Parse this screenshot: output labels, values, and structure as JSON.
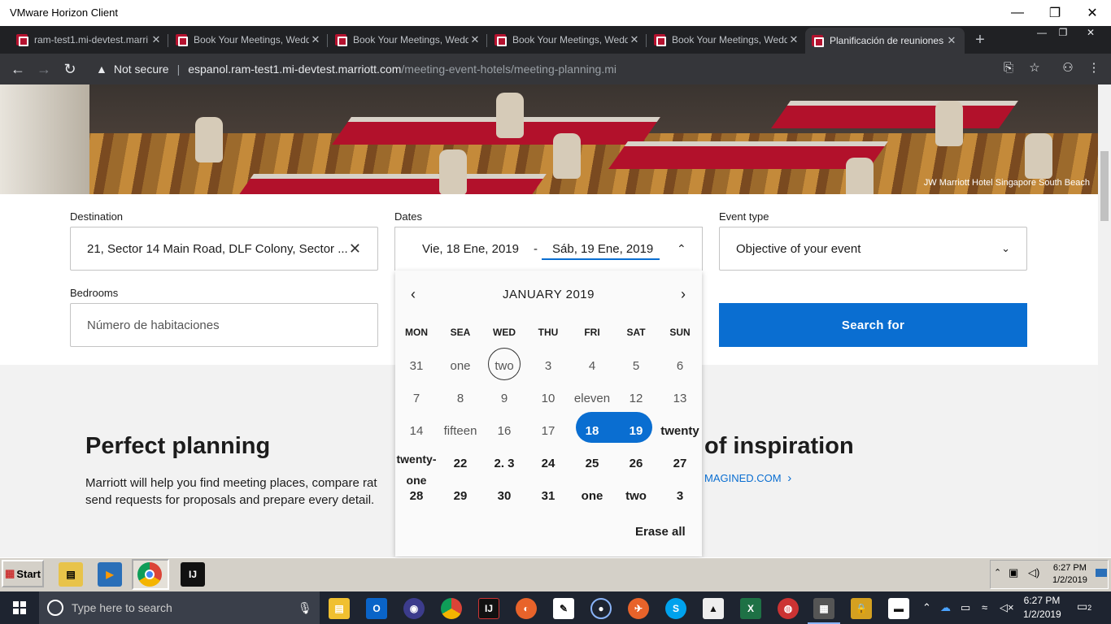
{
  "horizon": {
    "title": "VMware Horizon Client"
  },
  "window_controls": {
    "minimize": "—",
    "restore": "❐",
    "close": "✕"
  },
  "tabs": [
    {
      "label": "ram-test1.mi-devtest.marri"
    },
    {
      "label": "Book Your Meetings, Weddi"
    },
    {
      "label": "Book Your Meetings, Weddi"
    },
    {
      "label": "Book Your Meetings, Weddi"
    },
    {
      "label": "Book Your Meetings, Weddi"
    },
    {
      "label": "Planificación de reuniones d"
    }
  ],
  "toolbar": {
    "not_secure": "Not secure",
    "url_host": "espanol.ram-test1.mi-devtest.marriott.com",
    "url_path": "/meeting-event-hotels/meeting-planning.mi"
  },
  "hero": {
    "caption": "JW Marriott Hotel Singapore South Beach"
  },
  "form": {
    "destination_label": "Destination",
    "destination_value": "21, Sector 14 Main Road, DLF Colony, Sector ...",
    "dates_label": "Dates",
    "date_start": "Vie, 18 Ene, 2019",
    "date_dash": "-",
    "date_end": "Sáb, 19 Ene, 2019",
    "event_type_label": "Event type",
    "event_type_value": "Objective of your event",
    "bedrooms_label": "Bedrooms",
    "bedrooms_placeholder": "Número de habitaciones",
    "search_button": "Search for"
  },
  "calendar": {
    "month": "JANUARY 2019",
    "weekdays": [
      "MON",
      "SEA",
      "WED",
      "THU",
      "FRI",
      "SAT",
      "SUN"
    ],
    "weeks": [
      [
        "31",
        "one",
        "two",
        "3",
        "4",
        "5",
        "6"
      ],
      [
        "7",
        "8",
        "9",
        "10",
        "eleven",
        "12",
        "13"
      ],
      [
        "14",
        "fifteen",
        "16",
        "17",
        "18",
        "19",
        "twenty"
      ],
      [
        "twenty-one",
        "22",
        "2. 3",
        "24",
        "25",
        "26",
        "27"
      ],
      [
        "28",
        "29",
        "30",
        "31",
        "one",
        "two",
        "3"
      ]
    ],
    "erase_all": "Erase all"
  },
  "content": {
    "perfect_title": "Perfect planning",
    "perfect_text": "Marriott will help you find meeting places, compare rat send requests for proposals and prepare every detail.",
    "inspo_title": "of inspiration",
    "inspo_link": "MAGINED.COM"
  },
  "horizon_taskbar": {
    "start": "Start",
    "time": "6:27 PM",
    "date": "1/2/2019"
  },
  "win_taskbar": {
    "search_placeholder": "Type here to search",
    "time": "6:27 PM",
    "date": "1/2/2019",
    "notifications": "2"
  }
}
